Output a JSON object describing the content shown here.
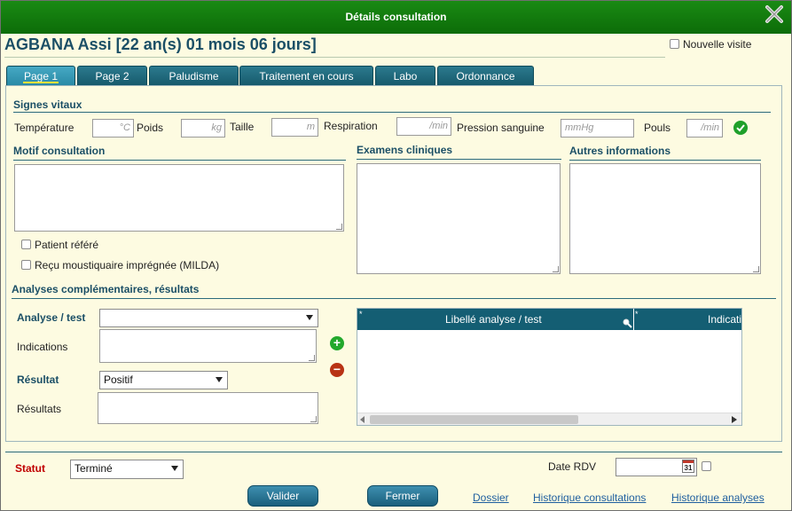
{
  "window": {
    "title": "Détails consultation"
  },
  "patient": {
    "name": "AGBANA Assi [22 an(s) 01 mois 06 jours]"
  },
  "nouvelle_visite": {
    "label": "Nouvelle visite",
    "checked": false
  },
  "tabs": [
    {
      "label": "Page 1",
      "active": true
    },
    {
      "label": "Page 2",
      "active": false
    },
    {
      "label": "Paludisme",
      "active": false
    },
    {
      "label": "Traitement en cours",
      "active": false
    },
    {
      "label": "Labo",
      "active": false
    },
    {
      "label": "Ordonnance",
      "active": false
    }
  ],
  "vitals": {
    "title": "Signes vitaux",
    "temperature": {
      "label": "Température",
      "unit": "°C"
    },
    "poids": {
      "label": "Poids",
      "unit": "kg"
    },
    "taille": {
      "label": "Taille",
      "unit": "m"
    },
    "respiration": {
      "label": "Respiration",
      "unit": "/min"
    },
    "pression": {
      "label": "Pression sanguine",
      "unit": "mmHg"
    },
    "pouls": {
      "label": "Pouls",
      "unit": "/min"
    }
  },
  "motif": {
    "title": "Motif consultation",
    "value": ""
  },
  "examens": {
    "title": "Examens cliniques",
    "value": ""
  },
  "autres": {
    "title": "Autres informations",
    "value": ""
  },
  "checks": {
    "patient_refere": "Patient référé",
    "moustiquaire": "Reçu moustiquaire imprégnée (MILDA)"
  },
  "analyses": {
    "title": "Analyses complémentaires, résultats",
    "analyse_label": "Analyse / test",
    "analyse_value": "",
    "indications_label": "Indications",
    "resultat_label": "Résultat",
    "resultat_value": "Positif",
    "resultats_label": "Résultats",
    "grid_columns": [
      "Libellé analyse / test",
      "Indicati"
    ]
  },
  "footer": {
    "statut_label": "Statut",
    "statut_value": "Terminé",
    "date_rdv_label": "Date RDV",
    "date_rdv_value": "",
    "calendar_day": "31",
    "valider": "Valider",
    "fermer": "Fermer",
    "dossier": "Dossier",
    "historique_consultations": "Historique consultations",
    "historique_analyses": "Historique analyses"
  },
  "colors": {
    "title_bar": "#0c6c08",
    "accent": "#1b4f66",
    "tab": "#175a6c",
    "statut": "#c00000"
  }
}
